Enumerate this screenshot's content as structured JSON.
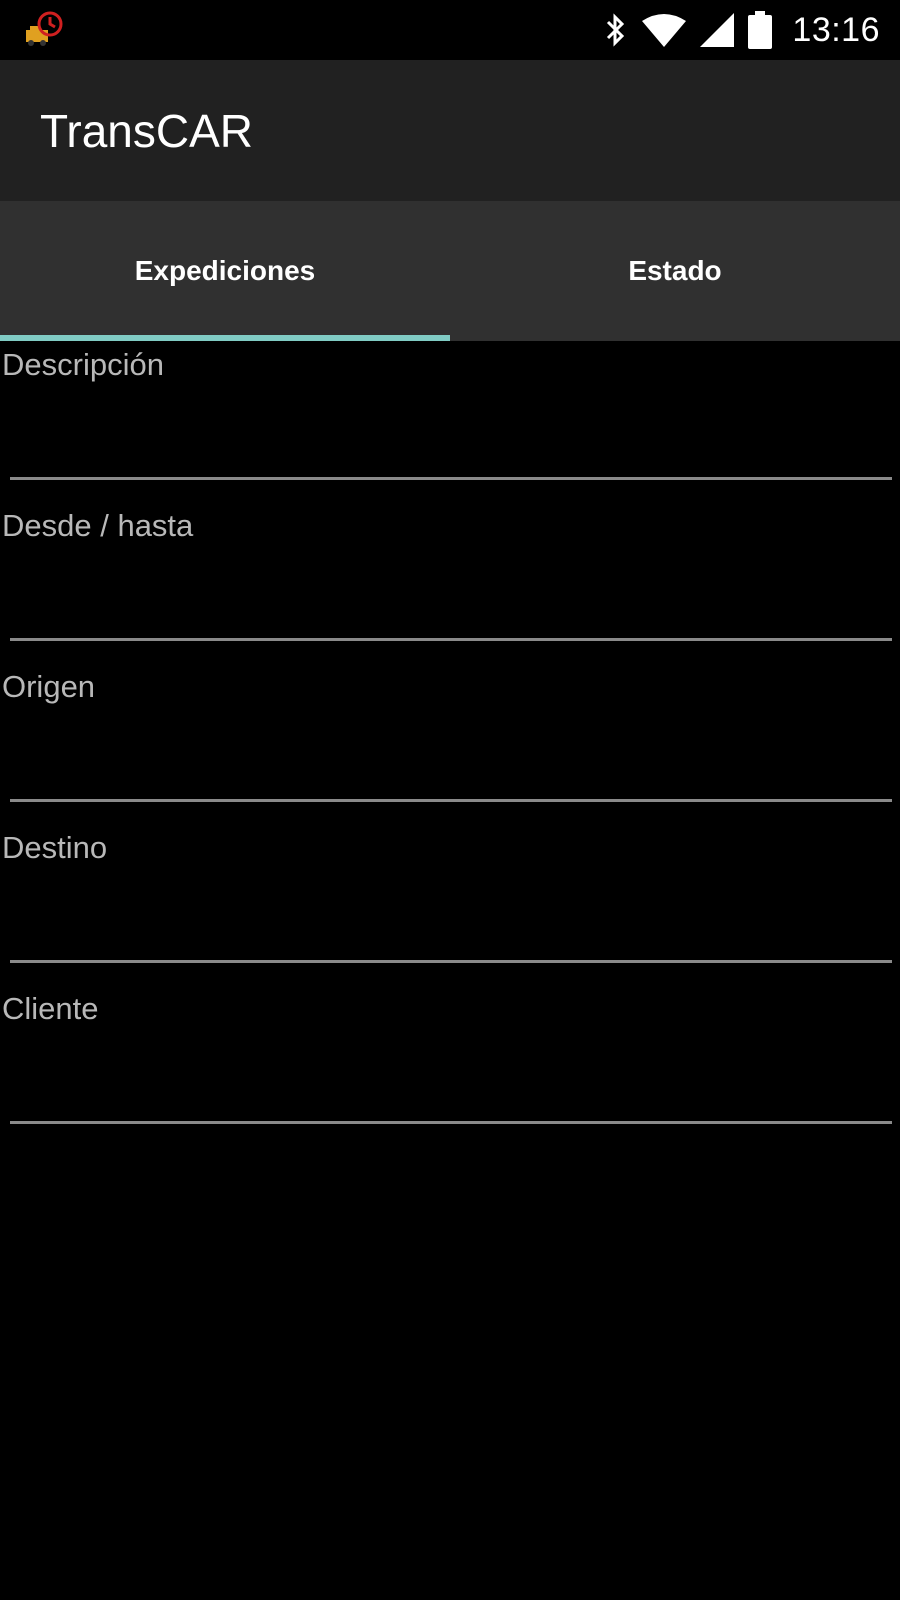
{
  "status_bar": {
    "notification_icon": "transcar-app-icon",
    "icons": [
      "bluetooth-icon",
      "wifi-icon",
      "cell-signal-icon",
      "battery-icon"
    ],
    "time": "13:16"
  },
  "app_bar": {
    "title": "TransCAR"
  },
  "tabs": [
    {
      "label": "Expediciones",
      "selected": true
    },
    {
      "label": "Estado",
      "selected": false
    }
  ],
  "colors": {
    "tab_indicator": "#80cbc4",
    "app_bar": "#212121",
    "tab_bar": "#303030",
    "background": "#000000"
  },
  "form": {
    "fields": [
      {
        "label": "Descripción",
        "value": ""
      },
      {
        "label": "Desde / hasta",
        "value": ""
      },
      {
        "label": "Origen",
        "value": ""
      },
      {
        "label": "Destino",
        "value": ""
      },
      {
        "label": "Cliente",
        "value": ""
      }
    ]
  }
}
